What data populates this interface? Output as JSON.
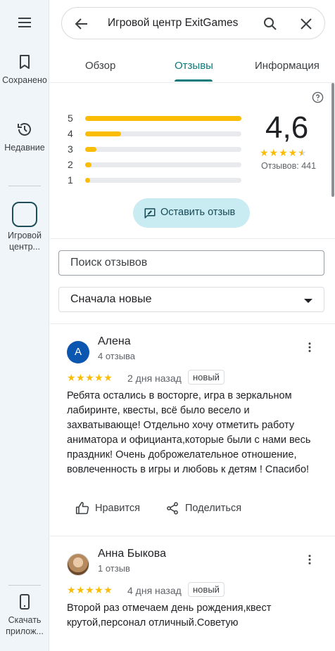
{
  "rail": {
    "saved_label": "Сохранено",
    "recent_label": "Недавние",
    "place_label": "Игровой центр...",
    "download_label": "Скачать прилож..."
  },
  "search": {
    "query": "Игровой центр ExitGames"
  },
  "tabs": [
    {
      "label": "Обзор"
    },
    {
      "label": "Отзывы"
    },
    {
      "label": "Информация"
    }
  ],
  "active_tab": "Отзывы",
  "summary": {
    "rating": "4,6",
    "stars_shown": 4.5,
    "reviews_count": "Отзывов: 441",
    "distribution": [
      {
        "stars": "5",
        "fraction": 1.0
      },
      {
        "stars": "4",
        "fraction": 0.23
      },
      {
        "stars": "3",
        "fraction": 0.07
      },
      {
        "stars": "2",
        "fraction": 0.04
      },
      {
        "stars": "1",
        "fraction": 0.03
      }
    ],
    "write_review_label": "Оставить отзыв"
  },
  "filter": {
    "search_placeholder": "Поиск отзывов",
    "sort_value": "Сначала новые"
  },
  "reviews": [
    {
      "avatar_letter": "А",
      "name": "Алена",
      "count": "4 отзыва",
      "stars": "★★★★★",
      "date": "2 дня назад",
      "badge": "новый",
      "text": "Ребята остались в восторге, игра в зеркальном лабиринте, квесты, всё было весело и захватывающе! Отдельно хочу отметить работу аниматора и официанта,которые были с нами весь праздник! Очень доброжелательное отношение, вовлеченность в игры и любовь к детям ! Спасибо!",
      "like_label": "Нравится",
      "share_label": "Поделиться"
    },
    {
      "name": "Анна Быкова",
      "count": "1 отзыв",
      "stars": "★★★★★",
      "date": "4 дня назад",
      "badge": "новый",
      "text": "Второй раз отмечаем день рождения,квест крутой,персонал отличный.Советую"
    }
  ],
  "colors": {
    "accent": "#0b7a7a",
    "star": "#fbbc04",
    "rail_bg": "#f0f5f9",
    "write_button_bg": "#c8ecf2"
  }
}
